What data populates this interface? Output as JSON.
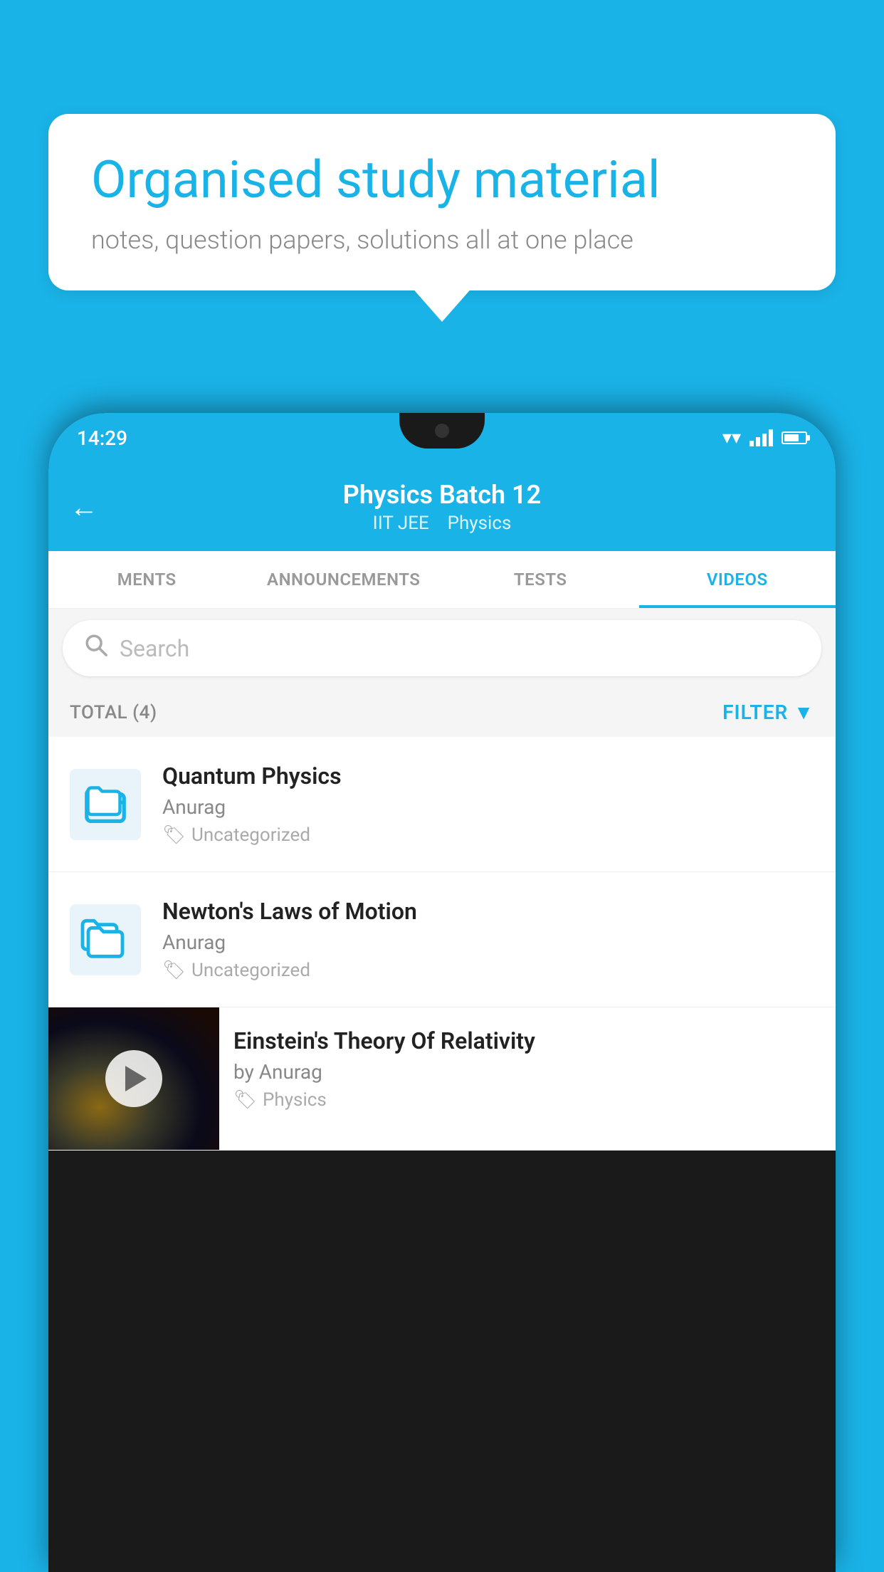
{
  "background_color": "#1ab3e8",
  "speech_bubble": {
    "heading": "Organised study material",
    "subtext": "notes, question papers, solutions all at one place"
  },
  "status_bar": {
    "time": "14:29"
  },
  "app_header": {
    "back_label": "←",
    "title": "Physics Batch 12",
    "subtitle_parts": [
      "IIT JEE",
      "Physics"
    ]
  },
  "tabs": [
    {
      "label": "MENTS",
      "active": false
    },
    {
      "label": "ANNOUNCEMENTS",
      "active": false
    },
    {
      "label": "TESTS",
      "active": false
    },
    {
      "label": "VIDEOS",
      "active": true
    }
  ],
  "search": {
    "placeholder": "Search"
  },
  "filter_bar": {
    "total_label": "TOTAL (4)",
    "filter_label": "FILTER"
  },
  "videos": [
    {
      "title": "Quantum Physics",
      "author": "Anurag",
      "tag": "Uncategorized",
      "type": "folder"
    },
    {
      "title": "Newton's Laws of Motion",
      "author": "Anurag",
      "tag": "Uncategorized",
      "type": "folder"
    },
    {
      "title": "Einstein's Theory Of Relativity",
      "author": "by Anurag",
      "tag": "Physics",
      "type": "video"
    }
  ]
}
